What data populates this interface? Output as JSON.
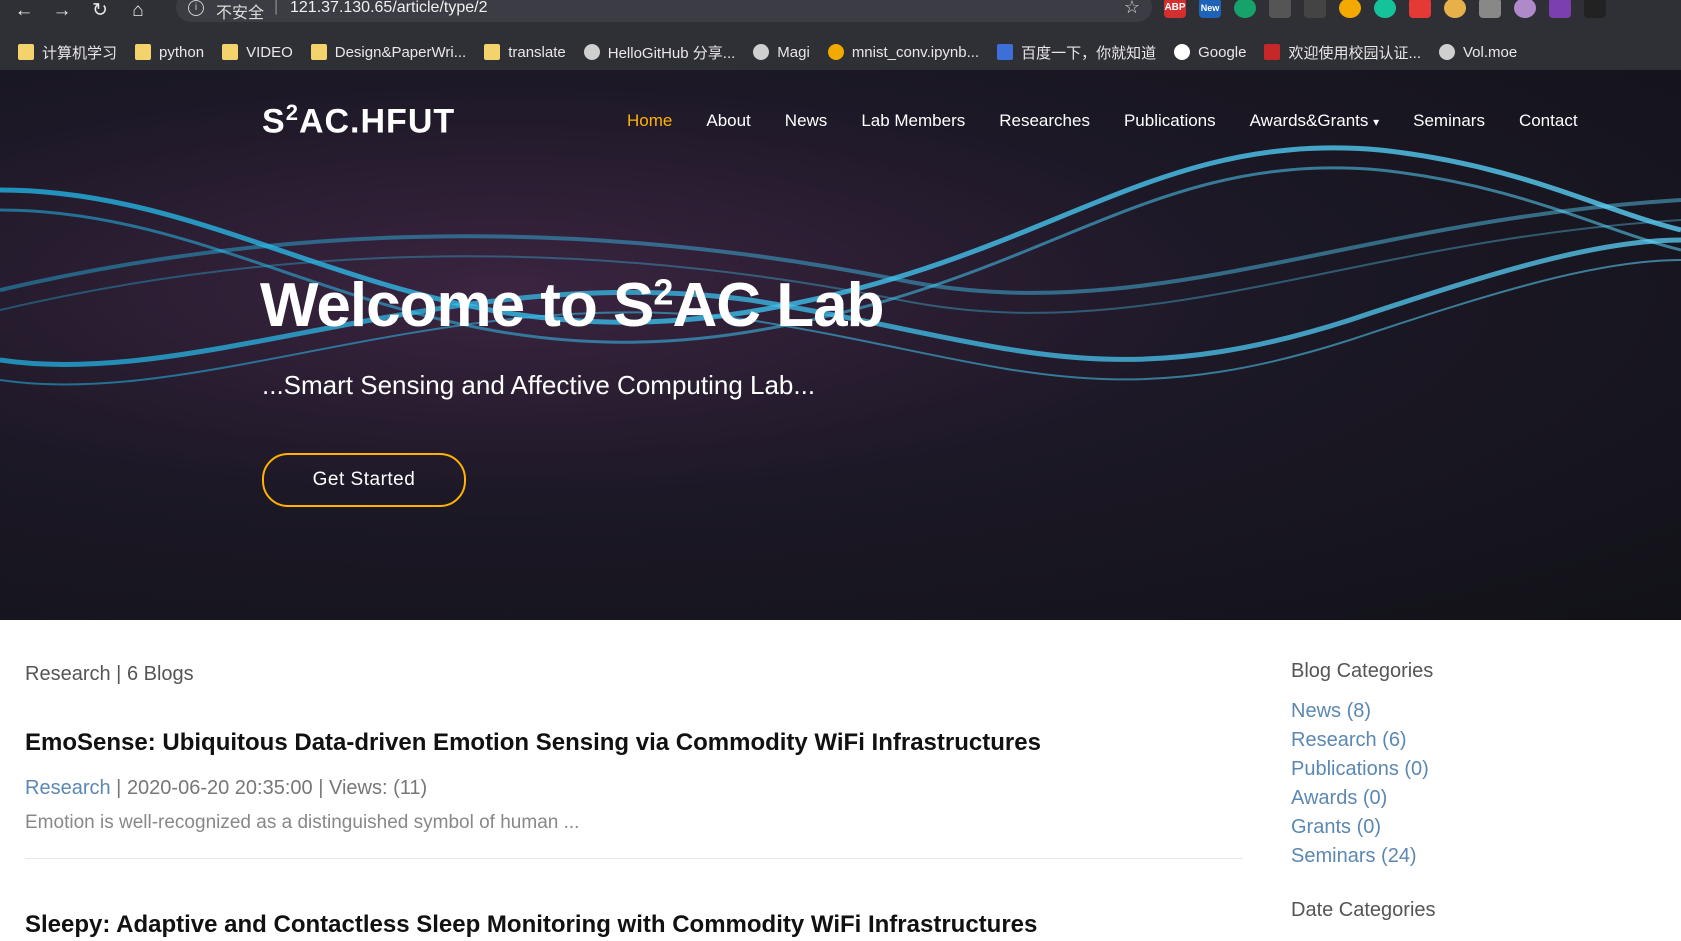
{
  "browser": {
    "security_label": "不安全",
    "url": "121.37.130.65/article/type/2",
    "extensions": [
      "ABP",
      "New",
      "",
      "",
      "",
      "",
      "",
      "",
      "",
      "",
      "",
      "",
      "",
      ""
    ],
    "bookmarks": [
      {
        "label": "计算机学习",
        "icon": "folder-icon"
      },
      {
        "label": "python",
        "icon": "folder-icon"
      },
      {
        "label": "VIDEO",
        "icon": "folder-icon"
      },
      {
        "label": "Design&PaperWri...",
        "icon": "folder-icon"
      },
      {
        "label": "translate",
        "icon": "folder-icon"
      },
      {
        "label": "HelloGitHub 分享...",
        "icon": "github-icon"
      },
      {
        "label": "Magi",
        "icon": "globe-icon"
      },
      {
        "label": "mnist_conv.ipynb...",
        "icon": "colab-icon"
      },
      {
        "label": "百度一下，你就知道",
        "icon": "baidu-icon"
      },
      {
        "label": "Google",
        "icon": "google-icon"
      },
      {
        "label": "欢迎使用校园认证...",
        "icon": "campus-icon"
      },
      {
        "label": "Vol.moe",
        "icon": "globe-icon"
      }
    ]
  },
  "site": {
    "logo_prefix": "S",
    "logo_sup": "2",
    "logo_suffix": "AC.HFUT",
    "menu": [
      {
        "label": "Home",
        "active": true
      },
      {
        "label": "About"
      },
      {
        "label": "News"
      },
      {
        "label": "Lab Members"
      },
      {
        "label": "Researches"
      },
      {
        "label": "Publications"
      },
      {
        "label": "Awards&Grants"
      },
      {
        "label": "Seminars"
      },
      {
        "label": "Contact"
      }
    ],
    "dropdown_icon": "chevron-down-icon"
  },
  "hero": {
    "title_prefix": "Welcome to S",
    "title_sup": "2",
    "title_suffix": "AC Lab",
    "subtitle": "...Smart Sensing and Affective Computing Lab...",
    "cta_label": "Get Started"
  },
  "listing": {
    "category": "Research",
    "separator": "|",
    "count_label": "6 Blogs",
    "posts": [
      {
        "title": "EmoSense: Ubiquitous Data-driven Emotion Sensing via Commodity WiFi Infrastructures",
        "category": "Research",
        "date": "2020-06-20 20:35:00",
        "views": "Views: (11)",
        "excerpt": "Emotion is well-recognized as a distinguished symbol of human ..."
      },
      {
        "title": "Sleepy: Adaptive and Contactless Sleep Monitoring with Commodity WiFi Infrastructures"
      }
    ]
  },
  "sidebar": {
    "blog_categories_title": "Blog Categories",
    "categories": [
      {
        "label": "News (8)"
      },
      {
        "label": "Research (6)"
      },
      {
        "label": "Publications (0)"
      },
      {
        "label": "Awards (0)"
      },
      {
        "label": "Grants (0)"
      },
      {
        "label": "Seminars (24)"
      }
    ],
    "date_categories_title": "Date Categories"
  }
}
